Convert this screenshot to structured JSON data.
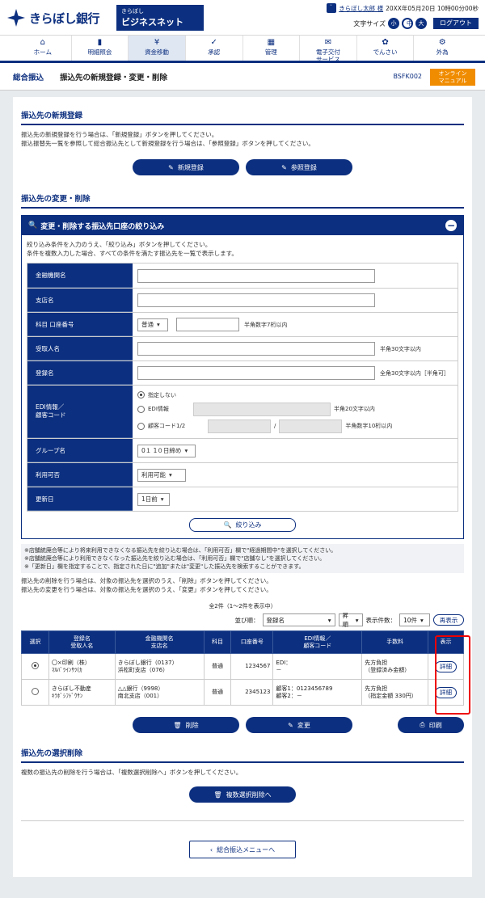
{
  "header": {
    "bank_name": "きらぼし銀行",
    "net_small": "きらぼし",
    "net_big": "ビジネスネット",
    "user_icon": "id-card-icon",
    "user_name": "きらぼし太郎 様",
    "datetime": "20XX年05月20日 10時00分00秒",
    "font_size_label": "文字サイズ",
    "font_small": "小",
    "font_mid": "中",
    "font_large": "大",
    "logout": "ログアウト"
  },
  "nav": [
    {
      "icon": "⌂",
      "label": "ホーム"
    },
    {
      "icon": "▮",
      "label": "明細照会"
    },
    {
      "icon": "¥",
      "label": "資金移動"
    },
    {
      "icon": "✓",
      "label": "承認"
    },
    {
      "icon": "▦",
      "label": "管理"
    },
    {
      "icon": "✉",
      "label": "電子交付\nサービス"
    },
    {
      "icon": "✿",
      "label": "でんさい"
    },
    {
      "icon": "⚙",
      "label": "外為"
    }
  ],
  "crumb": {
    "section": "総合振込",
    "title": "振込先の新規登録・変更・削除",
    "code": "BSFK002",
    "manual": "オンライン\nマニュアル"
  },
  "new_reg": {
    "title": "振込先の新規登録",
    "note1": "振込先の新規登録を行う場合は、「新規登録」ボタンを押してください。",
    "note2": "振込振替先一覧を参照して総合振込先として新規登録を行う場合は、「参照登録」ボタンを押してください。",
    "btn_new": "新規登録",
    "btn_ref": "参照登録"
  },
  "change": {
    "title": "振込先の変更・削除",
    "panel_title": "変更・削除する振込先口座の絞り込み",
    "note1": "絞り込み条件を入力のうえ、「絞り込み」ボタンを押してください。",
    "note2": "条件を複数入力した場合、すべての条件を満たす振込先を一覧で表示します。"
  },
  "form": {
    "bank": "金融機関名",
    "branch": "支店名",
    "account": "科目 口座番号",
    "acc_type": "普通",
    "acc_hint": "半角数字7桁以内",
    "payee": "受取人名",
    "payee_hint": "半角30文字以内",
    "regname": "登録名",
    "regname_hint": "全角30文字以内［半角可］",
    "edi": "EDI情報／\n顧客コード",
    "edi_opt1": "指定しない",
    "edi_opt2": "EDI情報",
    "edi_hint": "半角20文字以内",
    "edi_opt3": "顧客コード1/2",
    "cust_hint": "半角数字10桁以内",
    "group": "グループ名",
    "group_val": "0１ 1０日締め",
    "avail": "利用可否",
    "avail_val": "利用可能",
    "update": "更新日",
    "update_val": "1日前",
    "filter_btn": "絞り込み"
  },
  "notes": [
    "※店舗統廃合等により将来利用できなくなる振込先を絞り込む場合は、「利用可否」欄で\"経過期間中\"を選択してください。",
    "※店舗統廃合等により利用できなくなった振込先を絞り込む場合は、「利用可否」欄で\"店舗なし\"を選択してください。",
    "※「更新日」欄を指定することで、指定された日に\"追加\"または\"変更\"した振込先を検索することができます。",
    "振込先の削除を行う場合は、対象の振込先を選択のうえ、「削除」ボタンを押してください。",
    "振込先の変更を行う場合は、対象の振込先を選択のうえ、「変更」ボタンを押してください。"
  ],
  "list": {
    "count": "全2件（1〜2件を表示中）",
    "sort_label": "並び順：",
    "sort_val": "登録名",
    "order": "昇順",
    "per_label": "表示件数：",
    "per_val": "10件",
    "redisplay": "再表示",
    "headers": [
      "選択",
      "登録名\n受取人名",
      "金融機関名\n支店名",
      "科目",
      "口座番号",
      "EDI情報／\n顧客コード",
      "手数料",
      "表示"
    ],
    "rows": [
      {
        "name": "〇×印刷（株）",
        "kana": "ﾏﾙﾊﾞﾂｲﾝｻﾂ(ｶ",
        "bank": "きらぼし銀行（0137）",
        "branch": "浜松町支店（076）",
        "type": "普通",
        "acct": "1234567",
        "edi1": "EDI：",
        "edi2": "－",
        "fee1": "先方負担",
        "fee2": "（登録済み金額）",
        "detail": "詳細"
      },
      {
        "name": "きらぼし不動産",
        "kana": "ｷﾗﾎﾞｼﾌﾄﾞｳｻﾝ",
        "bank": "△△銀行（9998）",
        "branch": "南北支店（001）",
        "type": "普通",
        "acct": "2345123",
        "edi1": "顧客1：0123456789",
        "edi2": "顧客2：－",
        "fee1": "先方負担",
        "fee2": "（指定金額 330円）",
        "detail": "詳細"
      }
    ],
    "btn_delete": "削除",
    "btn_change": "変更",
    "btn_print": "印刷"
  },
  "bulk": {
    "title": "振込先の選択削除",
    "note": "複数の振込先の削除を行う場合は、「複数選択削除へ」ボタンを押してください。",
    "btn": "複数選択削除へ"
  },
  "back": {
    "label": "総合振込メニューへ"
  },
  "colors": {
    "primary": "#0c2f7f",
    "accent": "#f08c00",
    "highlight": "#e00000"
  }
}
